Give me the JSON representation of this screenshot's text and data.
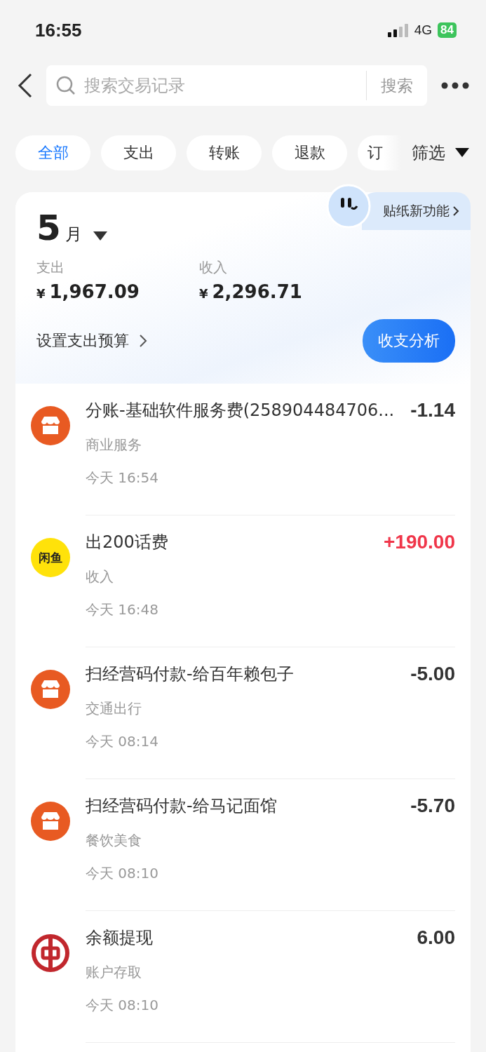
{
  "status_bar": {
    "time": "16:55",
    "network": "4G",
    "battery": "84"
  },
  "search": {
    "placeholder": "搜索交易记录",
    "button": "搜索"
  },
  "filters": [
    {
      "label": "全部",
      "selected": true
    },
    {
      "label": "支出",
      "selected": false
    },
    {
      "label": "转账",
      "selected": false
    },
    {
      "label": "退款",
      "selected": false
    },
    {
      "label": "订",
      "selected": false
    }
  ],
  "filter_button": "筛选",
  "summary": {
    "month": "5",
    "month_unit": "月",
    "sticker_badge": "贴纸新功能",
    "expense_label": "支出",
    "expense": "1,967.09",
    "income_label": "收入",
    "income": "2,296.71",
    "currency": "¥",
    "budget_link": "设置支出预算",
    "analysis_button": "收支分析"
  },
  "transactions": [
    {
      "kind": "shop",
      "title": "分账-基础软件服务费(258904484706...",
      "category": "商业服务",
      "time": "今天 16:54",
      "amount": "-1.14",
      "highlight": false
    },
    {
      "kind": "fish",
      "logo_text": "闲鱼",
      "title": "出200话费",
      "category": "收入",
      "time": "今天 16:48",
      "amount": "+190.00",
      "highlight": true
    },
    {
      "kind": "shop",
      "title": "扫经营码付款-给百年赖包子",
      "category": "交通出行",
      "time": "今天 08:14",
      "amount": "-5.00",
      "highlight": false
    },
    {
      "kind": "shop",
      "title": "扫经营码付款-给马记面馆",
      "category": "餐饮美食",
      "time": "今天 08:10",
      "amount": "-5.70",
      "highlight": false
    },
    {
      "kind": "bank",
      "title": "余额提现",
      "category": "账户存取",
      "time": "今天 08:10",
      "amount": "6.00",
      "highlight": false
    }
  ]
}
